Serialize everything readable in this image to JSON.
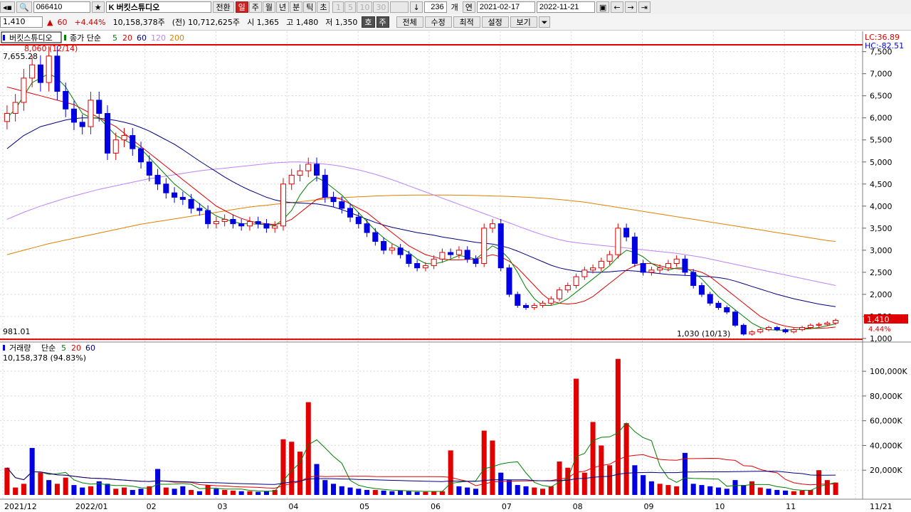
{
  "toolbar": {
    "code": "066410",
    "name": "K 버킷스튜디오",
    "switch_label": "전환",
    "periods": [
      "일",
      "주",
      "월",
      "년",
      "분",
      "틱",
      "초"
    ],
    "active_period": "일",
    "intervals": [
      "1",
      "5",
      "10",
      "30"
    ],
    "count": "236",
    "count_unit": "개",
    "year_label": "연",
    "date_from": "2021-02-17",
    "date_to": "2022-11-21"
  },
  "quote": {
    "price": "1,410",
    "change": "60",
    "change_pct": "+4.44%",
    "volume": "10,158,378주",
    "prev_volume": "(전) 10,712,625주",
    "open": "시 1,365",
    "high": "고 1,480",
    "low": "저 1,350",
    "buttons": [
      "호",
      "주"
    ],
    "menus": [
      "전체",
      "수정",
      "최적",
      "설정",
      "보기"
    ]
  },
  "colors": {
    "up": "#e00000",
    "down": "#0000e0",
    "ma5": "#008000",
    "ma20": "#e00000",
    "ma60": "#000080",
    "ma120": "#c080ff",
    "ma200": "#e08000",
    "hline": "#e00000"
  },
  "price_panel": {
    "legend": [
      "버킷스튜디오",
      "종가 단순",
      "5",
      "20",
      "60",
      "120",
      "200"
    ],
    "lc": "LC:36.89",
    "hc": "HC:-82.51",
    "high_marker": "8,060 (12/14)",
    "high_line_label": "7,655.28",
    "low_line_label": "981.01",
    "low_marker": "1,030 (10/13)",
    "last_price": "1,410",
    "last_pct": "4.44%"
  },
  "volume_panel": {
    "legend": [
      "거래량",
      "단순",
      "5",
      "20",
      "60"
    ],
    "last_volume": "10,158,378 (94.83%)"
  },
  "chart_data": [
    {
      "type": "candlestick",
      "title": "버킷스튜디오",
      "x_range": [
        "2021-12",
        "2022-11-21"
      ],
      "ylim": [
        1000,
        7800
      ],
      "yticks": [
        1000,
        1500,
        2000,
        2500,
        3000,
        3500,
        4000,
        4500,
        5000,
        5500,
        6000,
        6500,
        7000,
        7500
      ],
      "ytick_labels": [
        "1,000",
        "1,500",
        "2,000",
        "2,500",
        "3,000",
        "3,500",
        "4,000",
        "4,500",
        "5,000",
        "5,500",
        "6,000",
        "6,500",
        "7,000",
        "7,500"
      ],
      "xticks": [
        "2021/12",
        "2022/01",
        "02",
        "03",
        "04",
        "05",
        "06",
        "07",
        "08",
        "09",
        "10",
        "11",
        "11/21"
      ],
      "hlines": [
        7655.28,
        981.01
      ],
      "close": [
        6100,
        6350,
        6900,
        7200,
        6800,
        7400,
        6600,
        6200,
        5900,
        5800,
        6400,
        6100,
        5200,
        5500,
        5600,
        5300,
        5000,
        4700,
        4500,
        4300,
        4200,
        4150,
        3950,
        3900,
        3600,
        3650,
        3700,
        3600,
        3550,
        3650,
        3600,
        3500,
        3550,
        4500,
        4700,
        4800,
        4950,
        4700,
        4200,
        4100,
        3950,
        3750,
        3600,
        3400,
        3200,
        3000,
        3050,
        2900,
        2700,
        2600,
        2650,
        2800,
        2950,
        2900,
        3000,
        2800,
        2700,
        3500,
        3600,
        2600,
        2000,
        1750,
        1700,
        1750,
        1800,
        1900,
        2100,
        2200,
        2400,
        2550,
        2600,
        2750,
        2900,
        3500,
        3300,
        2700,
        2500,
        2550,
        2600,
        2700,
        2800,
        2500,
        2200,
        2000,
        1800,
        1700,
        1600,
        1300,
        1100,
        1150,
        1200,
        1250,
        1200,
        1150,
        1200,
        1250,
        1300,
        1320,
        1350,
        1410
      ],
      "ma5": [
        6000,
        6200,
        6500,
        6800,
        6900,
        7000,
        6900,
        6700,
        6400,
        6100,
        6000,
        6000,
        5800,
        5600,
        5500,
        5400,
        5300,
        5100,
        4900,
        4700,
        4500,
        4350,
        4200,
        4050,
        3900,
        3780,
        3700,
        3650,
        3600,
        3600,
        3590,
        3580,
        3560,
        3700,
        3900,
        4250,
        4500,
        4650,
        4550,
        4400,
        4250,
        4050,
        3850,
        3650,
        3450,
        3280,
        3150,
        3050,
        2950,
        2800,
        2700,
        2690,
        2730,
        2800,
        2880,
        2850,
        2800,
        2950,
        3100,
        3000,
        2800,
        2500,
        2150,
        1900,
        1750,
        1750,
        1800,
        1900,
        2050,
        2200,
        2350,
        2500,
        2650,
        2850,
        3000,
        2950,
        2850,
        2700,
        2600,
        2550,
        2600,
        2600,
        2500,
        2350,
        2150,
        1950,
        1800,
        1650,
        1500,
        1350,
        1250,
        1200,
        1190,
        1190,
        1200,
        1210,
        1220,
        1250,
        1290,
        1330
      ],
      "ma20": [
        6700,
        6650,
        6600,
        6550,
        6500,
        6450,
        6400,
        6350,
        6300,
        6200,
        6100,
        6000,
        5900,
        5800,
        5650,
        5500,
        5350,
        5200,
        5050,
        4900,
        4750,
        4600,
        4450,
        4300,
        4150,
        4000,
        3900,
        3800,
        3720,
        3660,
        3620,
        3600,
        3580,
        3620,
        3700,
        3850,
        4000,
        4150,
        4200,
        4200,
        4150,
        4050,
        3950,
        3850,
        3700,
        3550,
        3400,
        3250,
        3100,
        3000,
        2900,
        2850,
        2800,
        2780,
        2780,
        2790,
        2800,
        2850,
        2900,
        2850,
        2750,
        2600,
        2400,
        2200,
        2000,
        1850,
        1800,
        1780,
        1800,
        1850,
        1950,
        2100,
        2250,
        2400,
        2550,
        2650,
        2700,
        2700,
        2650,
        2600,
        2580,
        2570,
        2550,
        2500,
        2400,
        2250,
        2100,
        1950,
        1800,
        1650,
        1500,
        1400,
        1330,
        1280,
        1250,
        1240,
        1230,
        1230,
        1240,
        1260
      ],
      "ma60": [
        5300,
        5450,
        5600,
        5700,
        5800,
        5850,
        5900,
        5950,
        5980,
        6000,
        6000,
        5990,
        5970,
        5940,
        5900,
        5850,
        5780,
        5700,
        5600,
        5500,
        5400,
        5280,
        5150,
        5020,
        4900,
        4780,
        4660,
        4550,
        4450,
        4360,
        4280,
        4200,
        4140,
        4100,
        4080,
        4070,
        4060,
        4050,
        4020,
        3980,
        3920,
        3850,
        3780,
        3700,
        3630,
        3570,
        3520,
        3480,
        3440,
        3400,
        3370,
        3340,
        3300,
        3270,
        3240,
        3210,
        3180,
        3160,
        3140,
        3100,
        3050,
        2980,
        2900,
        2820,
        2740,
        2660,
        2600,
        2560,
        2530,
        2510,
        2500,
        2500,
        2510,
        2530,
        2540,
        2530,
        2510,
        2490,
        2470,
        2450,
        2440,
        2430,
        2420,
        2410,
        2400,
        2380,
        2350,
        2300,
        2240,
        2180,
        2120,
        2060,
        2000,
        1950,
        1900,
        1860,
        1820,
        1780,
        1750,
        1720
      ],
      "ma120": [
        3700,
        3780,
        3860,
        3930,
        4000,
        4060,
        4120,
        4180,
        4230,
        4280,
        4330,
        4380,
        4420,
        4460,
        4500,
        4540,
        4580,
        4620,
        4650,
        4680,
        4710,
        4740,
        4770,
        4800,
        4820,
        4840,
        4860,
        4880,
        4900,
        4920,
        4940,
        4960,
        4980,
        4990,
        5000,
        5000,
        4990,
        4970,
        4950,
        4930,
        4900,
        4860,
        4820,
        4770,
        4720,
        4660,
        4600,
        4530,
        4460,
        4390,
        4320,
        4250,
        4180,
        4110,
        4040,
        3970,
        3900,
        3830,
        3760,
        3690,
        3620,
        3550,
        3480,
        3410,
        3350,
        3290,
        3240,
        3200,
        3170,
        3150,
        3130,
        3110,
        3090,
        3070,
        3050,
        3030,
        3010,
        2990,
        2970,
        2950,
        2930,
        2900,
        2870,
        2840,
        2800,
        2760,
        2720,
        2680,
        2640,
        2600,
        2560,
        2520,
        2480,
        2440,
        2400,
        2360,
        2320,
        2280,
        2240,
        2200
      ],
      "ma200": [
        2900,
        2950,
        3000,
        3050,
        3100,
        3150,
        3190,
        3230,
        3270,
        3310,
        3350,
        3390,
        3430,
        3470,
        3510,
        3550,
        3590,
        3620,
        3650,
        3680,
        3710,
        3740,
        3770,
        3800,
        3830,
        3860,
        3890,
        3920,
        3950,
        3980,
        4000,
        4020,
        4040,
        4060,
        4080,
        4100,
        4120,
        4140,
        4160,
        4180,
        4190,
        4200,
        4210,
        4220,
        4230,
        4235,
        4240,
        4245,
        4248,
        4250,
        4250,
        4250,
        4250,
        4250,
        4248,
        4245,
        4240,
        4235,
        4230,
        4225,
        4220,
        4210,
        4200,
        4190,
        4180,
        4165,
        4150,
        4130,
        4110,
        4090,
        4060,
        4030,
        4000,
        3970,
        3940,
        3910,
        3880,
        3850,
        3820,
        3790,
        3760,
        3730,
        3700,
        3670,
        3640,
        3610,
        3580,
        3550,
        3520,
        3490,
        3460,
        3430,
        3400,
        3370,
        3340,
        3310,
        3280,
        3250,
        3220,
        3200
      ]
    },
    {
      "type": "bar",
      "title": "거래량",
      "ylim": [
        0,
        115000
      ],
      "yticks": [
        20000,
        40000,
        60000,
        80000,
        100000
      ],
      "ytick_labels": [
        "20,000K",
        "40,000K",
        "60,000K",
        "80,000K",
        "100,000K"
      ],
      "values": [
        22000,
        6000,
        9000,
        38000,
        18000,
        12000,
        9000,
        14000,
        8000,
        6000,
        7000,
        11000,
        9000,
        5000,
        6000,
        4000,
        5000,
        7000,
        21000,
        6000,
        5000,
        7000,
        4000,
        3000,
        8000,
        5000,
        4000,
        3500,
        3000,
        3000,
        2500,
        3000,
        4000,
        45000,
        43000,
        35000,
        75000,
        25000,
        12000,
        9000,
        7000,
        6000,
        5000,
        4000,
        4000,
        3500,
        3000,
        3500,
        3000,
        2500,
        2500,
        3000,
        3000,
        36000,
        7000,
        6000,
        5000,
        52000,
        44000,
        18000,
        12000,
        8000,
        7000,
        6000,
        5000,
        7000,
        27000,
        22000,
        94000,
        18000,
        59000,
        40000,
        24000,
        110000,
        58000,
        24000,
        16000,
        11000,
        9000,
        8000,
        7000,
        34000,
        9000,
        8000,
        7000,
        6000,
        5000,
        12000,
        8000,
        11000,
        6000,
        5000,
        4000,
        3500,
        3000,
        3500,
        4000,
        20000,
        12000,
        10000
      ],
      "up": [
        1,
        1,
        1,
        0,
        1,
        0,
        1,
        1,
        0,
        0,
        1,
        0,
        0,
        1,
        1,
        0,
        0,
        1,
        0,
        1,
        0,
        0,
        1,
        0,
        1,
        0,
        1,
        1,
        0,
        1,
        0,
        0,
        1,
        1,
        1,
        1,
        1,
        0,
        0,
        0,
        0,
        0,
        0,
        0,
        1,
        0,
        0,
        0,
        0,
        0,
        1,
        1,
        1,
        1,
        0,
        0,
        0,
        1,
        1,
        0,
        0,
        0,
        0,
        1,
        1,
        1,
        1,
        1,
        1,
        1,
        1,
        1,
        1,
        1,
        1,
        0,
        0,
        0,
        1,
        1,
        1,
        0,
        0,
        0,
        0,
        0,
        0,
        0,
        0,
        1,
        1,
        0,
        0,
        0,
        1,
        1,
        1,
        1,
        1,
        1
      ]
    }
  ]
}
